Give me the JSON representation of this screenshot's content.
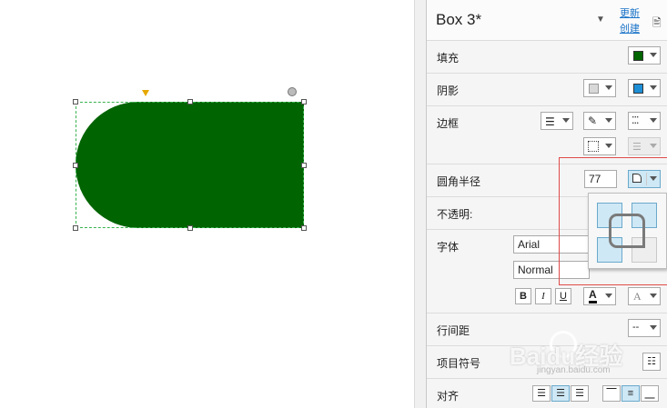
{
  "panel": {
    "title": "Box 3*",
    "link_update": "更新",
    "link_create": "创建"
  },
  "rows": {
    "fill_label": "填充",
    "shadow_label": "阴影",
    "border_label": "边框",
    "radius_label": "圆角半径",
    "radius_value": "77",
    "opacity_label": "不透明:",
    "font_label": "字体",
    "font_family": "Arial",
    "font_style": "Normal",
    "bold": "B",
    "italic": "I",
    "underline": "U",
    "text_color_glyph": "A",
    "text_shadow_glyph": "A",
    "line_spacing_label": "行间距",
    "line_spacing_value": "--",
    "bullets_label": "项目符号",
    "align_label": "对齐"
  },
  "colors": {
    "shape_fill": "#006400",
    "shadow_color": "#1f8fd6",
    "accent": "#1a73c8"
  },
  "watermark": {
    "text": "Baidu经验",
    "sub": "jingyan.baidu.com"
  }
}
